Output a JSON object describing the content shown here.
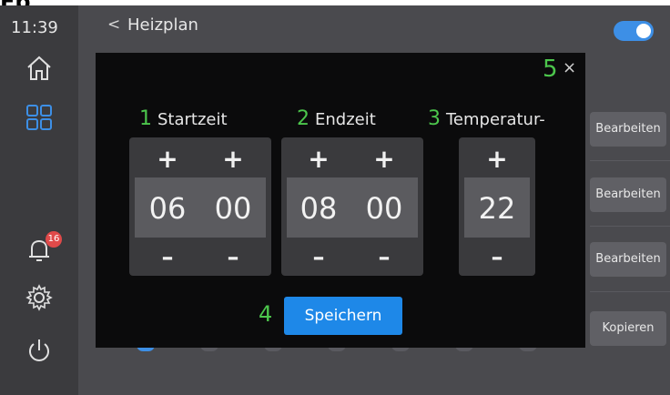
{
  "caption": "Fp",
  "status": {
    "time": "11:39"
  },
  "sidebar": {
    "items": [
      {
        "icon": "home-icon"
      },
      {
        "icon": "grid-icon"
      },
      {
        "icon": "bell-icon",
        "badge": "16"
      },
      {
        "icon": "gear-icon"
      },
      {
        "icon": "power-icon"
      }
    ]
  },
  "header": {
    "back_glyph": "<",
    "title": "Heizplan"
  },
  "background_list": {
    "buttons": [
      "Bearbeiten",
      "Bearbeiten",
      "Bearbeiten",
      "Kopieren"
    ]
  },
  "dialog": {
    "close_number": "5",
    "close_glyph": "×",
    "columns": [
      {
        "number": "1",
        "label": "Startzeit"
      },
      {
        "number": "2",
        "label": "Endzeit"
      },
      {
        "number": "3",
        "label": "Temperatur-"
      }
    ],
    "start": {
      "hour": "06",
      "minute": "00"
    },
    "end": {
      "hour": "08",
      "minute": "00"
    },
    "temperature": "22",
    "plus_glyph": "+",
    "minus_glyph": "–",
    "save_number": "4",
    "save_label": "Speichern"
  },
  "colors": {
    "accent_blue": "#1e88e8",
    "number_green": "#4cc64c",
    "badge_red": "#e04a4a"
  }
}
